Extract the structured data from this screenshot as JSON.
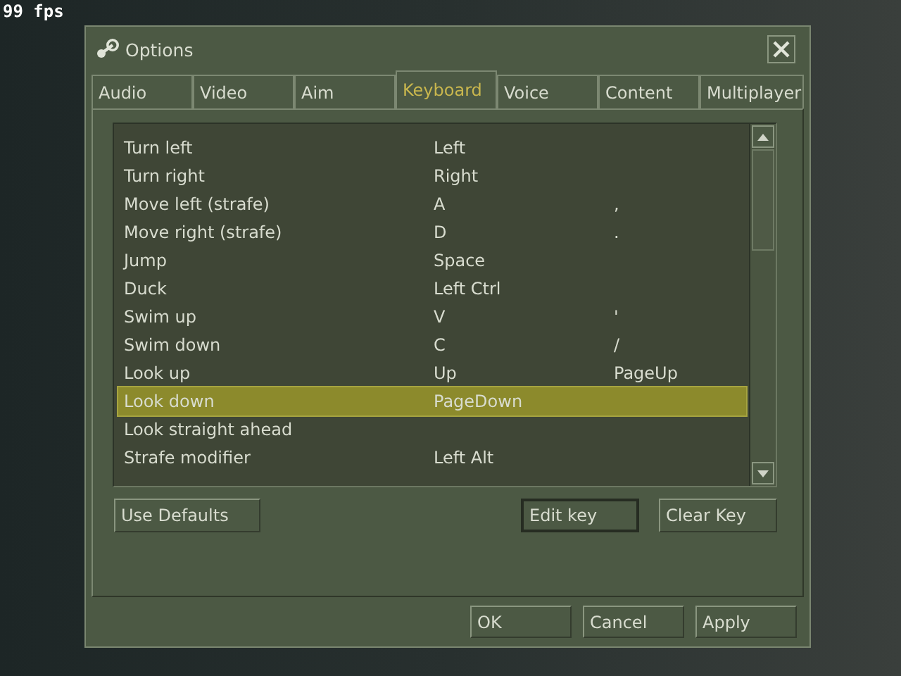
{
  "hud": {
    "fps": "99 fps"
  },
  "window": {
    "title": "Options"
  },
  "tabs": [
    {
      "label": "Audio",
      "selected": false
    },
    {
      "label": "Video",
      "selected": false
    },
    {
      "label": "Aim",
      "selected": false
    },
    {
      "label": "Keyboard",
      "selected": true
    },
    {
      "label": "Voice",
      "selected": false
    },
    {
      "label": "Content",
      "selected": false
    },
    {
      "label": "Multiplayer",
      "selected": false
    }
  ],
  "bindings": [
    {
      "action": "Turn left",
      "key": "Left",
      "selected": false
    },
    {
      "action": "Turn right",
      "key": "Right",
      "selected": false
    },
    {
      "action": "Move left (strafe)",
      "key": "A",
      "alternate": ",",
      "selected": false
    },
    {
      "action": "Move right (strafe)",
      "key": "D",
      "alternate": ".",
      "selected": false
    },
    {
      "action": "Jump",
      "key": "Space",
      "selected": false
    },
    {
      "action": "Duck",
      "key": "Left Ctrl",
      "selected": false
    },
    {
      "action": "Swim up",
      "key": "V",
      "alternate": "'",
      "selected": false
    },
    {
      "action": "Swim down",
      "key": "C",
      "alternate": "/",
      "selected": false
    },
    {
      "action": "Look up",
      "key": "Up",
      "alternate": "PageUp",
      "selected": false
    },
    {
      "action": "Look down",
      "key": "PageDown",
      "selected": true
    },
    {
      "action": "Look straight ahead",
      "selected": false
    },
    {
      "action": "Strafe modifier",
      "key": "Left Alt",
      "selected": false
    }
  ],
  "list_buttons": [
    {
      "label": "Use Defaults",
      "focused": false
    },
    {
      "label": "Edit key",
      "focused": true
    },
    {
      "label": "Clear Key",
      "focused": false
    }
  ],
  "dialog_buttons": [
    "OK",
    "Cancel",
    "Apply"
  ]
}
